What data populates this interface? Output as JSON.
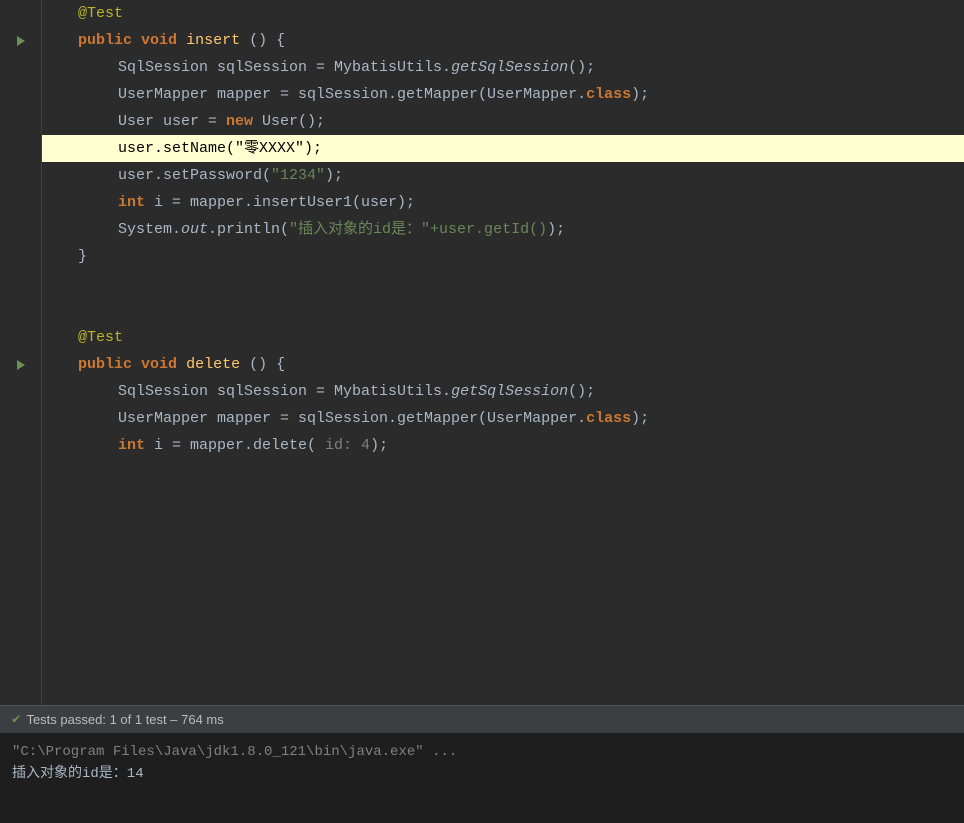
{
  "editor": {
    "background": "#2b2b2b",
    "highlight_color": "#ffffd0",
    "lines": [
      {
        "id": 1,
        "type": "annotation",
        "indent": 1,
        "tokens": [
          {
            "text": "@Test",
            "class": "annotation"
          }
        ]
      },
      {
        "id": 2,
        "type": "code",
        "indent": 1,
        "tokens": [
          {
            "text": "public",
            "class": "kw"
          },
          {
            "text": " "
          },
          {
            "text": "void",
            "class": "kw"
          },
          {
            "text": " "
          },
          {
            "text": "insert",
            "class": "method-name"
          },
          {
            "text": "() {"
          }
        ]
      },
      {
        "id": 3,
        "type": "code",
        "indent": 2,
        "tokens": [
          {
            "text": "SqlSession sqlSession = MybatisUtils."
          },
          {
            "text": "getSqlSession",
            "class": "italic"
          },
          {
            "text": "();"
          }
        ]
      },
      {
        "id": 4,
        "type": "code",
        "indent": 2,
        "tokens": [
          {
            "text": "UserMapper mapper = sqlSession.getMapper(UserMapper."
          },
          {
            "text": "class",
            "class": "kw"
          },
          {
            "text": ");"
          }
        ]
      },
      {
        "id": 5,
        "type": "code",
        "indent": 2,
        "tokens": [
          {
            "text": "User user = "
          },
          {
            "text": "new",
            "class": "kw"
          },
          {
            "text": " User();"
          }
        ]
      },
      {
        "id": 6,
        "type": "code",
        "indent": 2,
        "highlighted": true,
        "tokens": [
          {
            "text": "user.setName("
          },
          {
            "text": "\"零XXXX\"",
            "class": "string"
          },
          {
            "text": ");"
          }
        ]
      },
      {
        "id": 7,
        "type": "code",
        "indent": 2,
        "tokens": [
          {
            "text": "user.setPassword("
          },
          {
            "text": "\"1234\"",
            "class": "string"
          },
          {
            "text": ");"
          }
        ]
      },
      {
        "id": 8,
        "type": "code",
        "indent": 2,
        "tokens": [
          {
            "text": "int",
            "class": "kw-type"
          },
          {
            "text": " i = mapper.insertUser1(user);"
          }
        ]
      },
      {
        "id": 9,
        "type": "code",
        "indent": 2,
        "tokens": [
          {
            "text": "System."
          },
          {
            "text": "out",
            "class": "italic"
          },
          {
            "text": ".println("
          },
          {
            "text": "\"插入对象的id是：\"+user.getId()",
            "class": "string"
          },
          {
            "text": ");"
          }
        ]
      },
      {
        "id": 10,
        "type": "code",
        "indent": 1,
        "tokens": [
          {
            "text": "}"
          }
        ]
      },
      {
        "id": 11,
        "type": "empty"
      },
      {
        "id": 12,
        "type": "empty"
      },
      {
        "id": 13,
        "type": "annotation",
        "indent": 1,
        "tokens": [
          {
            "text": "@Test",
            "class": "annotation"
          }
        ]
      },
      {
        "id": 14,
        "type": "code",
        "indent": 1,
        "tokens": [
          {
            "text": "public",
            "class": "kw"
          },
          {
            "text": " "
          },
          {
            "text": "void",
            "class": "kw"
          },
          {
            "text": " "
          },
          {
            "text": "delete",
            "class": "method-name"
          },
          {
            "text": "() {"
          }
        ]
      },
      {
        "id": 15,
        "type": "code",
        "indent": 2,
        "tokens": [
          {
            "text": "SqlSession sqlSession = MybatisUtils."
          },
          {
            "text": "getSqlSession",
            "class": "italic"
          },
          {
            "text": "();"
          }
        ]
      },
      {
        "id": 16,
        "type": "code",
        "indent": 2,
        "tokens": [
          {
            "text": "UserMapper mapper = sqlSession.getMapper(UserMapper."
          },
          {
            "text": "class",
            "class": "kw"
          },
          {
            "text": ");"
          }
        ]
      },
      {
        "id": 17,
        "type": "code",
        "indent": 2,
        "tokens": [
          {
            "text": "int",
            "class": "kw-type"
          },
          {
            "text": " i = mapper.delete( "
          },
          {
            "text": "id: 4",
            "class": "param-hint"
          },
          {
            "text": ");"
          }
        ]
      },
      {
        "id": 18,
        "type": "empty"
      }
    ]
  },
  "bottom_bar": {
    "tests_label": "Tests passed:",
    "tests_count": "1 of 1 test",
    "tests_time": "– 764 ms"
  },
  "output": {
    "line1": "\"C:\\Program Files\\Java\\jdk1.8.0_121\\bin\\java.exe\" ...",
    "line2": "插入对象的id是：14"
  },
  "gutter_icons": {
    "insert_icon_row": 2,
    "delete_icon_row": 14
  }
}
